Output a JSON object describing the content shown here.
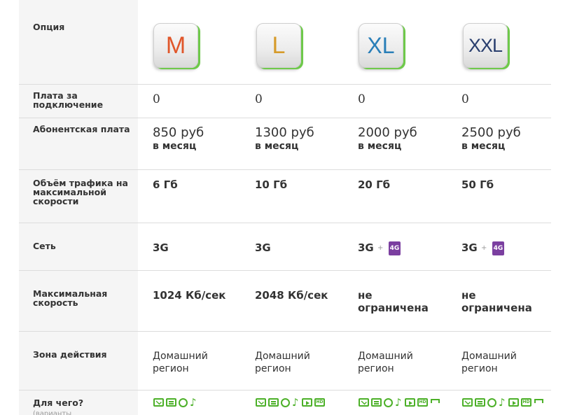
{
  "header": {
    "option_label": "Опция"
  },
  "plans": [
    {
      "letter": "M",
      "connection_fee": "0",
      "fee_amount": "850 руб",
      "fee_period": "в месяц",
      "traffic": "6 Гб",
      "network": "3G",
      "speed_line1": "1024 Кб/сек",
      "speed_line2": "",
      "zone_line1": "Домашний",
      "zone_line2": "регион"
    },
    {
      "letter": "L",
      "connection_fee": "0",
      "fee_amount": "1300 руб",
      "fee_period": "в месяц",
      "traffic": "10 Гб",
      "network": "3G",
      "speed_line1": "2048 Кб/сек",
      "speed_line2": "",
      "zone_line1": "Домашний",
      "zone_line2": "регион"
    },
    {
      "letter": "XL",
      "connection_fee": "0",
      "fee_amount": "2000 руб",
      "fee_period": "в месяц",
      "traffic": "20 Гб",
      "network": "3G",
      "speed_line1": "не",
      "speed_line2": "ограничена",
      "zone_line1": "Домашний",
      "zone_line2": "регион"
    },
    {
      "letter": "XXL",
      "connection_fee": "0",
      "fee_amount": "2500 руб",
      "fee_period": "в месяц",
      "traffic": "50 Гб",
      "network": "3G",
      "speed_line1": "не",
      "speed_line2": "ограничена",
      "zone_line1": "Домашний",
      "zone_line2": "регион"
    }
  ],
  "network_plus": "+",
  "network_4g": "4G",
  "hd_label": "HD",
  "rows": {
    "connection_label": "Плата за подключение",
    "fee_label": "Абонентская плата",
    "traffic_label": "Объём трафика на максимальной скорости",
    "network_label": "Сеть",
    "speed_label": "Максимальная скорость",
    "zone_label": "Зона действия",
    "usage_label": "Для чего?",
    "usage_sublabel": "(варианты использования)"
  },
  "accent_color": "#4cb028",
  "badge_color": "#7b3fa0"
}
